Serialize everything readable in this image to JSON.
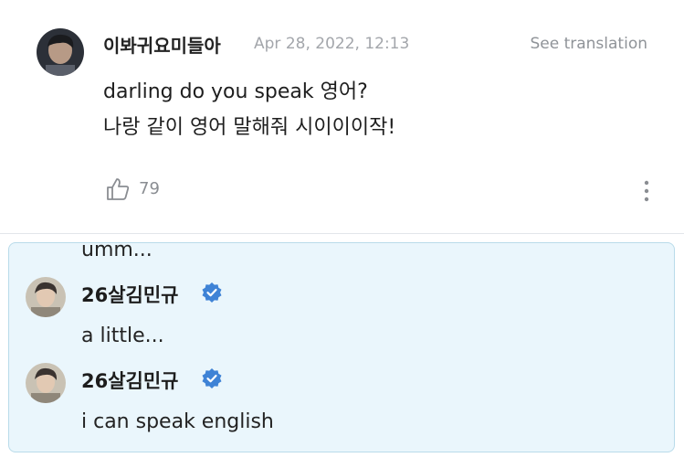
{
  "post": {
    "author": "이봐귀요미들아",
    "date": "Apr 28, 2022, 12:13",
    "translate_label": "See translation",
    "lines": [
      "darling do you speak 영어?",
      "나랑 같이 영어 말해줘 시이이이작!"
    ],
    "like_count": "79",
    "icons": {
      "like": "thumbs-up-icon",
      "more": "more-vertical-icon"
    }
  },
  "replies": {
    "partial_text": "umm...",
    "items": [
      {
        "name": "26살김민규",
        "text": "a little...",
        "verified": true
      },
      {
        "name": "26살김민규",
        "text": "i can speak english",
        "verified": true
      }
    ]
  },
  "colors": {
    "accent_verified": "#3f83d6",
    "reply_bg": "#eaf6fc",
    "reply_border": "#b9dbea"
  }
}
